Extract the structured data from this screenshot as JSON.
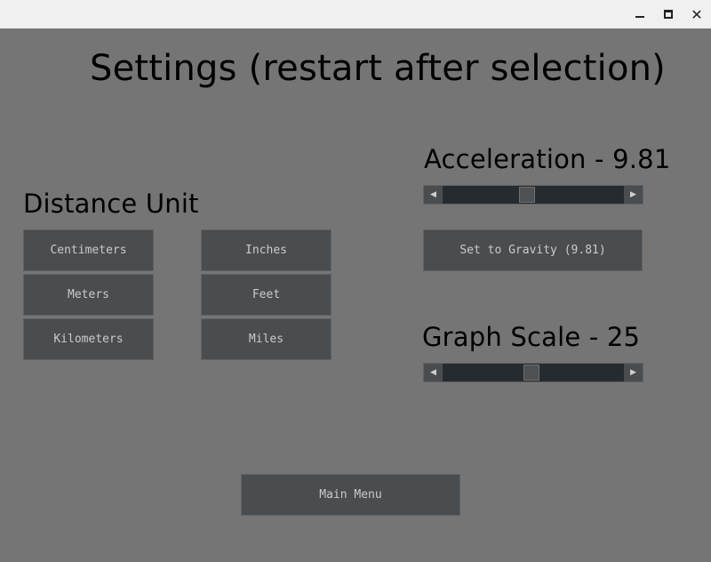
{
  "window": {
    "minimize_icon": "minimize-icon",
    "maximize_icon": "maximize-icon",
    "close_icon": "close-icon",
    "close_glyph": "✕"
  },
  "title": "Settings (restart after selection)",
  "distance_unit": {
    "heading": "Distance Unit",
    "buttons": [
      "Centimeters",
      "Meters",
      "Kilometers",
      "Inches",
      "Feet",
      "Miles"
    ]
  },
  "acceleration": {
    "heading": "Acceleration - 9.81",
    "value": 9.81,
    "slider_fraction": 0.46,
    "left_arrow": "◀",
    "right_arrow": "▶",
    "gravity_button": "Set to Gravity (9.81)"
  },
  "graph_scale": {
    "heading": "Graph Scale - 25",
    "value": 25,
    "slider_fraction": 0.49,
    "left_arrow": "◀",
    "right_arrow": "▶"
  },
  "main_menu": "Main Menu"
}
